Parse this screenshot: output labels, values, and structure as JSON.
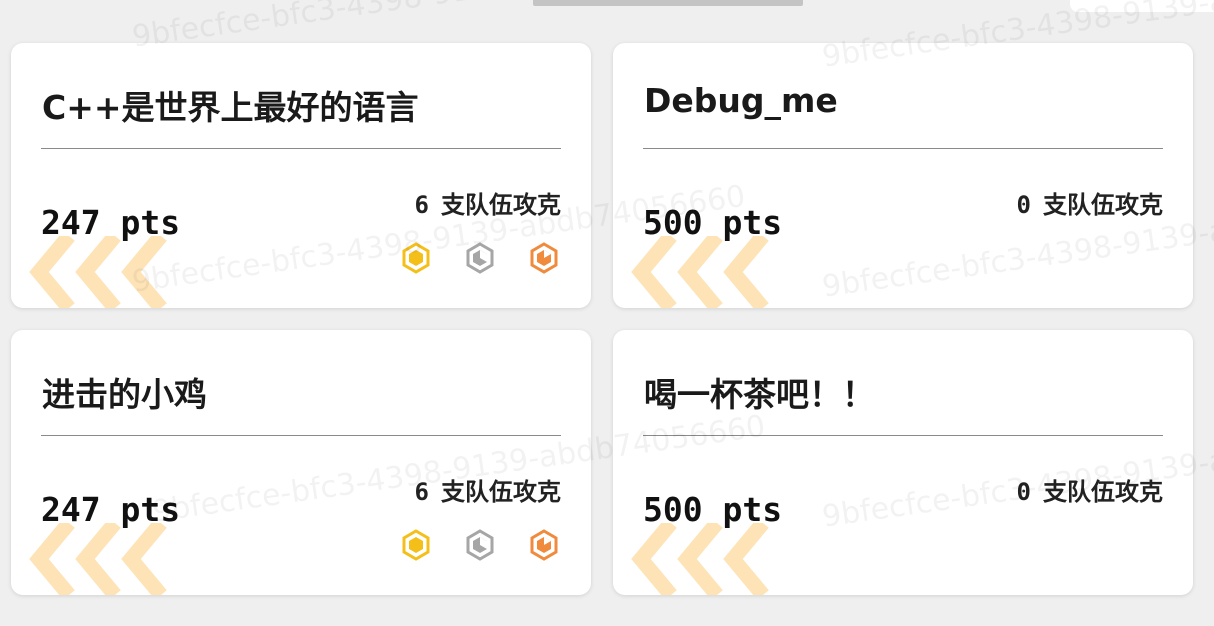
{
  "cards": [
    {
      "title": "C++是世界上最好的语言",
      "points": "247 pts",
      "solves_count": "6",
      "solves_label": "支队伍攻克",
      "show_medals": true
    },
    {
      "title": "Debug_me",
      "points": "500 pts",
      "solves_count": "0",
      "solves_label": "支队伍攻克",
      "show_medals": false
    },
    {
      "title": "进击的小鸡",
      "points": "247 pts",
      "solves_count": "6",
      "solves_label": "支队伍攻克",
      "show_medals": true
    },
    {
      "title": "喝一杯茶吧！！",
      "points": "500 pts",
      "solves_count": "0",
      "solves_label": "支队伍攻克",
      "show_medals": false
    }
  ],
  "medal_icons": [
    "gold-medal-icon",
    "silver-medal-icon",
    "bronze-medal-icon"
  ],
  "colors": {
    "gold": "#f5bf1a",
    "silver": "#a6a6a6",
    "bronze": "#f08a3c",
    "chevron": "#fde3b6"
  },
  "watermark_text": "9bfecfce-bfc3-4398-9139-abdb74056660"
}
